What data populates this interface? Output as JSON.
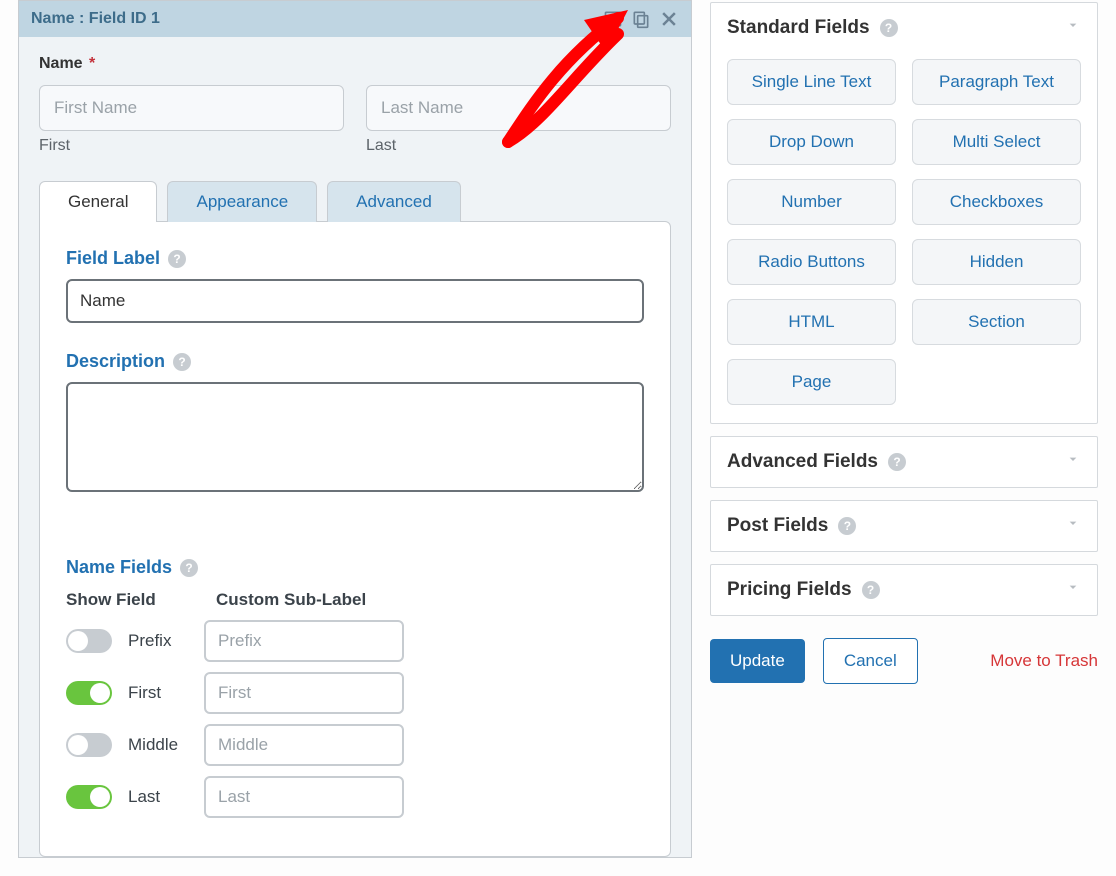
{
  "field_card": {
    "header_title": "Name : Field ID 1",
    "preview": {
      "label": "Name",
      "required_marker": "*",
      "first_placeholder": "First Name",
      "first_sublabel": "First",
      "last_placeholder": "Last Name",
      "last_sublabel": "Last"
    },
    "tabs": {
      "general": "General",
      "appearance": "Appearance",
      "advanced": "Advanced"
    },
    "settings": {
      "field_label_label": "Field Label",
      "field_label_value": "Name",
      "description_label": "Description",
      "description_value": "",
      "name_fields_label": "Name Fields",
      "cols": {
        "show": "Show Field",
        "sub": "Custom Sub-Label"
      },
      "rows": [
        {
          "key": "prefix",
          "label": "Prefix",
          "placeholder": "Prefix",
          "on": false
        },
        {
          "key": "first",
          "label": "First",
          "placeholder": "First",
          "on": true
        },
        {
          "key": "middle",
          "label": "Middle",
          "placeholder": "Middle",
          "on": false
        },
        {
          "key": "last",
          "label": "Last",
          "placeholder": "Last",
          "on": true
        }
      ]
    }
  },
  "sidebar": {
    "panels": {
      "standard": {
        "title": "Standard Fields",
        "items": [
          "Single Line Text",
          "Paragraph Text",
          "Drop Down",
          "Multi Select",
          "Number",
          "Checkboxes",
          "Radio Buttons",
          "Hidden",
          "HTML",
          "Section",
          "Page"
        ]
      },
      "advanced": {
        "title": "Advanced Fields"
      },
      "post": {
        "title": "Post Fields"
      },
      "pricing": {
        "title": "Pricing Fields"
      }
    },
    "actions": {
      "update": "Update",
      "cancel": "Cancel",
      "trash": "Move to Trash"
    }
  }
}
